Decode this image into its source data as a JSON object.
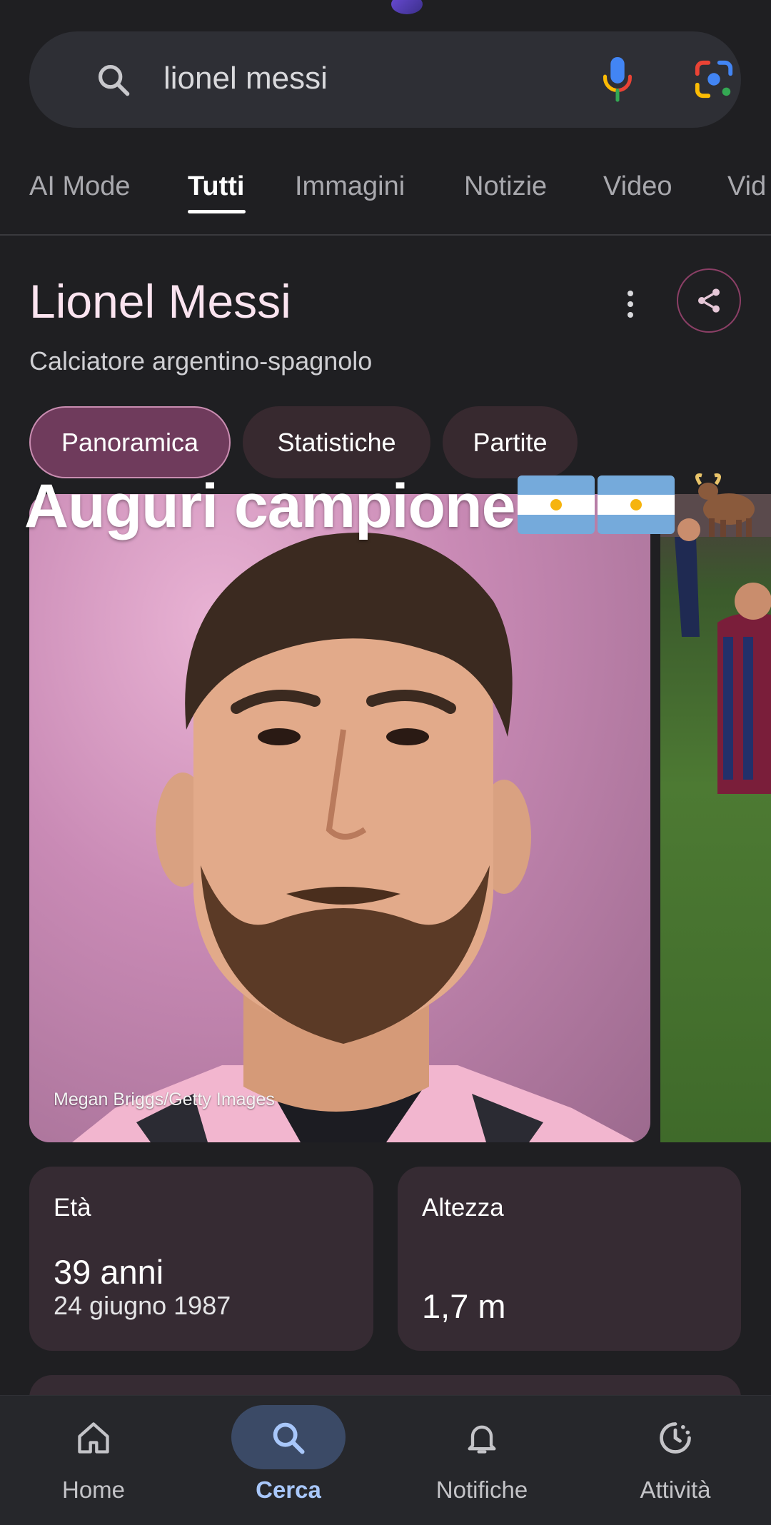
{
  "search": {
    "query": "lionel messi",
    "icons": {
      "search": "search-icon",
      "voice": "mic-icon",
      "lens": "lens-icon"
    }
  },
  "tabs": [
    {
      "label": "AI Mode",
      "active": false
    },
    {
      "label": "Tutti",
      "active": true
    },
    {
      "label": "Immagini",
      "active": false
    },
    {
      "label": "Notizie",
      "active": false
    },
    {
      "label": "Video",
      "active": false
    },
    {
      "label": "Vid",
      "active": false
    }
  ],
  "entity": {
    "title": "Lionel Messi",
    "subtitle": "Calciatore argentino-spagnolo",
    "icons": {
      "more": "more-vert-icon",
      "share": "share-icon"
    }
  },
  "chips": [
    {
      "label": "Panoramica",
      "active": true
    },
    {
      "label": "Statistiche",
      "active": false
    },
    {
      "label": "Partite",
      "active": false
    }
  ],
  "overlay": {
    "caption": "Auguri campione",
    "emoji": [
      "argentina-flag",
      "argentina-flag",
      "bull"
    ]
  },
  "images": {
    "main_credit": "Megan Briggs/Getty Images"
  },
  "facts": {
    "age": {
      "label": "Età",
      "value": "39 anni",
      "detail": "24 giugno 1987"
    },
    "height": {
      "label": "Altezza",
      "value": "1,7 m"
    }
  },
  "bottom_nav": [
    {
      "label": "Home",
      "icon": "home-icon",
      "active": false
    },
    {
      "label": "Cerca",
      "icon": "search-icon",
      "active": true
    },
    {
      "label": "Notifiche",
      "icon": "bell-icon",
      "active": false
    },
    {
      "label": "Attività",
      "icon": "activity-icon",
      "active": false
    }
  ],
  "colors": {
    "background": "#1f1f22",
    "chip_active": "#6f3b5c",
    "card": "#362b33",
    "nav_active": "#a8c7fa",
    "title": "#fbe4f0"
  }
}
